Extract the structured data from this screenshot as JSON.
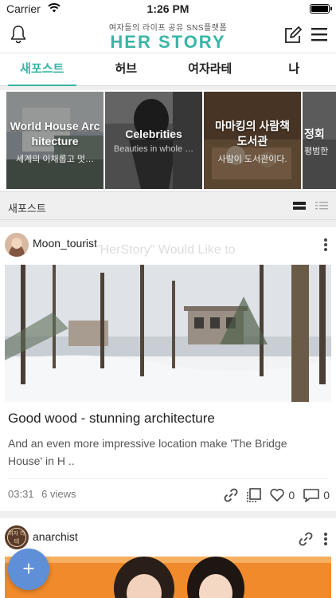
{
  "status_bar": {
    "carrier": "Carrier",
    "time": "1:26 PM"
  },
  "header": {
    "tagline": "여자들의 라이프 공유 SNS플랫폼",
    "logo": "HER STORY"
  },
  "tabs": [
    {
      "label": "새포스트",
      "active": true
    },
    {
      "label": "허브",
      "active": false
    },
    {
      "label": "여자라테",
      "active": false
    },
    {
      "label": "나",
      "active": false
    }
  ],
  "featured": [
    {
      "title": "World House Architecture",
      "title_line1": "World House Arc",
      "title_line2": "hitecture",
      "subtitle": "세계의 이채롭고 멋…"
    },
    {
      "title": "Celebrities",
      "subtitle": "Beauties in whole …"
    },
    {
      "title_line1": "마마킹의 사람책",
      "title_line2": "도서관",
      "subtitle": "사람이 도서관이다."
    },
    {
      "title_line1": "정회",
      "subtitle": "평범한"
    }
  ],
  "section": {
    "label": "새포스트"
  },
  "post1": {
    "author": "Moon_tourist",
    "overlay_text": "\"HerStory\" Would Like to",
    "title": "Good wood - stunning architecture",
    "excerpt": "And an even more impressive location make 'The Bridge House' in H ..",
    "time": "03:31",
    "views": "6 views",
    "likes": "0",
    "comments": "0"
  },
  "post2": {
    "author": "anarchist",
    "avatar_text": "여자 라테"
  },
  "fab": {
    "label": "+"
  },
  "colors": {
    "accent": "#3bb4a6",
    "fab": "#5f8fd6"
  },
  "icons": {
    "bell": "bell-icon",
    "edit": "edit-icon",
    "menu": "menu-icon",
    "link": "link-icon",
    "share": "share-icon",
    "heart": "heart-icon",
    "comment": "comment-icon",
    "more": "more-icon"
  }
}
